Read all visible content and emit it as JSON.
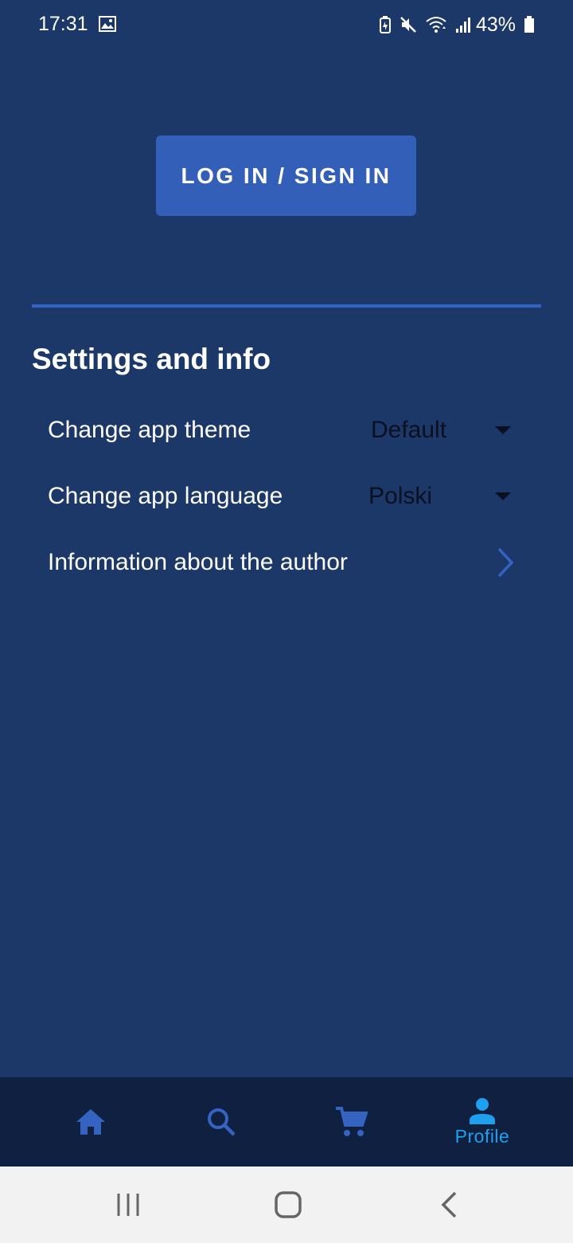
{
  "status_bar": {
    "time": "17:31",
    "battery_percent": "43%",
    "icons": [
      "image-icon",
      "battery-saver-icon",
      "mute-icon",
      "wifi-icon",
      "signal-icon",
      "battery-icon"
    ]
  },
  "login": {
    "button_label": "LOG IN / SIGN IN"
  },
  "settings": {
    "title": "Settings and info",
    "theme": {
      "label": "Change app theme",
      "selected": "Default"
    },
    "language": {
      "label": "Change app language",
      "selected": "Polski"
    },
    "author": {
      "label": "Information about the author"
    }
  },
  "bottom_nav": {
    "items": [
      {
        "icon": "home-icon",
        "label": ""
      },
      {
        "icon": "search-icon",
        "label": ""
      },
      {
        "icon": "cart-icon",
        "label": ""
      },
      {
        "icon": "profile-icon",
        "label": "Profile",
        "active": true
      }
    ]
  },
  "colors": {
    "background": "#1b3869",
    "accent": "#335fb8",
    "nav_background": "#0f2040",
    "active_nav": "#1fa0ee"
  }
}
